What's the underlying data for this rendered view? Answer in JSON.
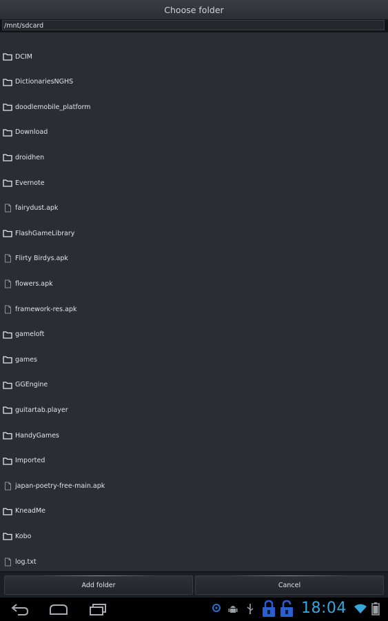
{
  "dialog": {
    "title": "Choose folder",
    "path": "/mnt/sdcard"
  },
  "entries": [
    {
      "name": "DCIM",
      "type": "folder"
    },
    {
      "name": "DictionariesNGHS",
      "type": "folder"
    },
    {
      "name": "doodlemobile_platform",
      "type": "folder"
    },
    {
      "name": "Download",
      "type": "folder"
    },
    {
      "name": "droidhen",
      "type": "folder"
    },
    {
      "name": "Evernote",
      "type": "folder"
    },
    {
      "name": "fairydust.apk",
      "type": "file"
    },
    {
      "name": "FlashGameLibrary",
      "type": "folder"
    },
    {
      "name": "Flirty Birdys.apk",
      "type": "file"
    },
    {
      "name": "flowers.apk",
      "type": "file"
    },
    {
      "name": "framework-res.apk",
      "type": "file"
    },
    {
      "name": "gameloft",
      "type": "folder"
    },
    {
      "name": "games",
      "type": "folder"
    },
    {
      "name": "GGEngine",
      "type": "folder"
    },
    {
      "name": "guitartab.player",
      "type": "folder"
    },
    {
      "name": "HandyGames",
      "type": "folder"
    },
    {
      "name": "Imported",
      "type": "folder"
    },
    {
      "name": "japan-poetry-free-main.apk",
      "type": "file"
    },
    {
      "name": "KneadMe",
      "type": "folder"
    },
    {
      "name": "Kobo",
      "type": "folder"
    },
    {
      "name": "log.txt",
      "type": "file"
    }
  ],
  "buttons": {
    "add_folder": "Add folder",
    "cancel": "Cancel"
  },
  "status": {
    "time": "18:04",
    "accent_color": "#37a7d9"
  },
  "nav": {
    "icons": [
      "back-icon",
      "home-icon",
      "recent-apps-icon"
    ]
  }
}
